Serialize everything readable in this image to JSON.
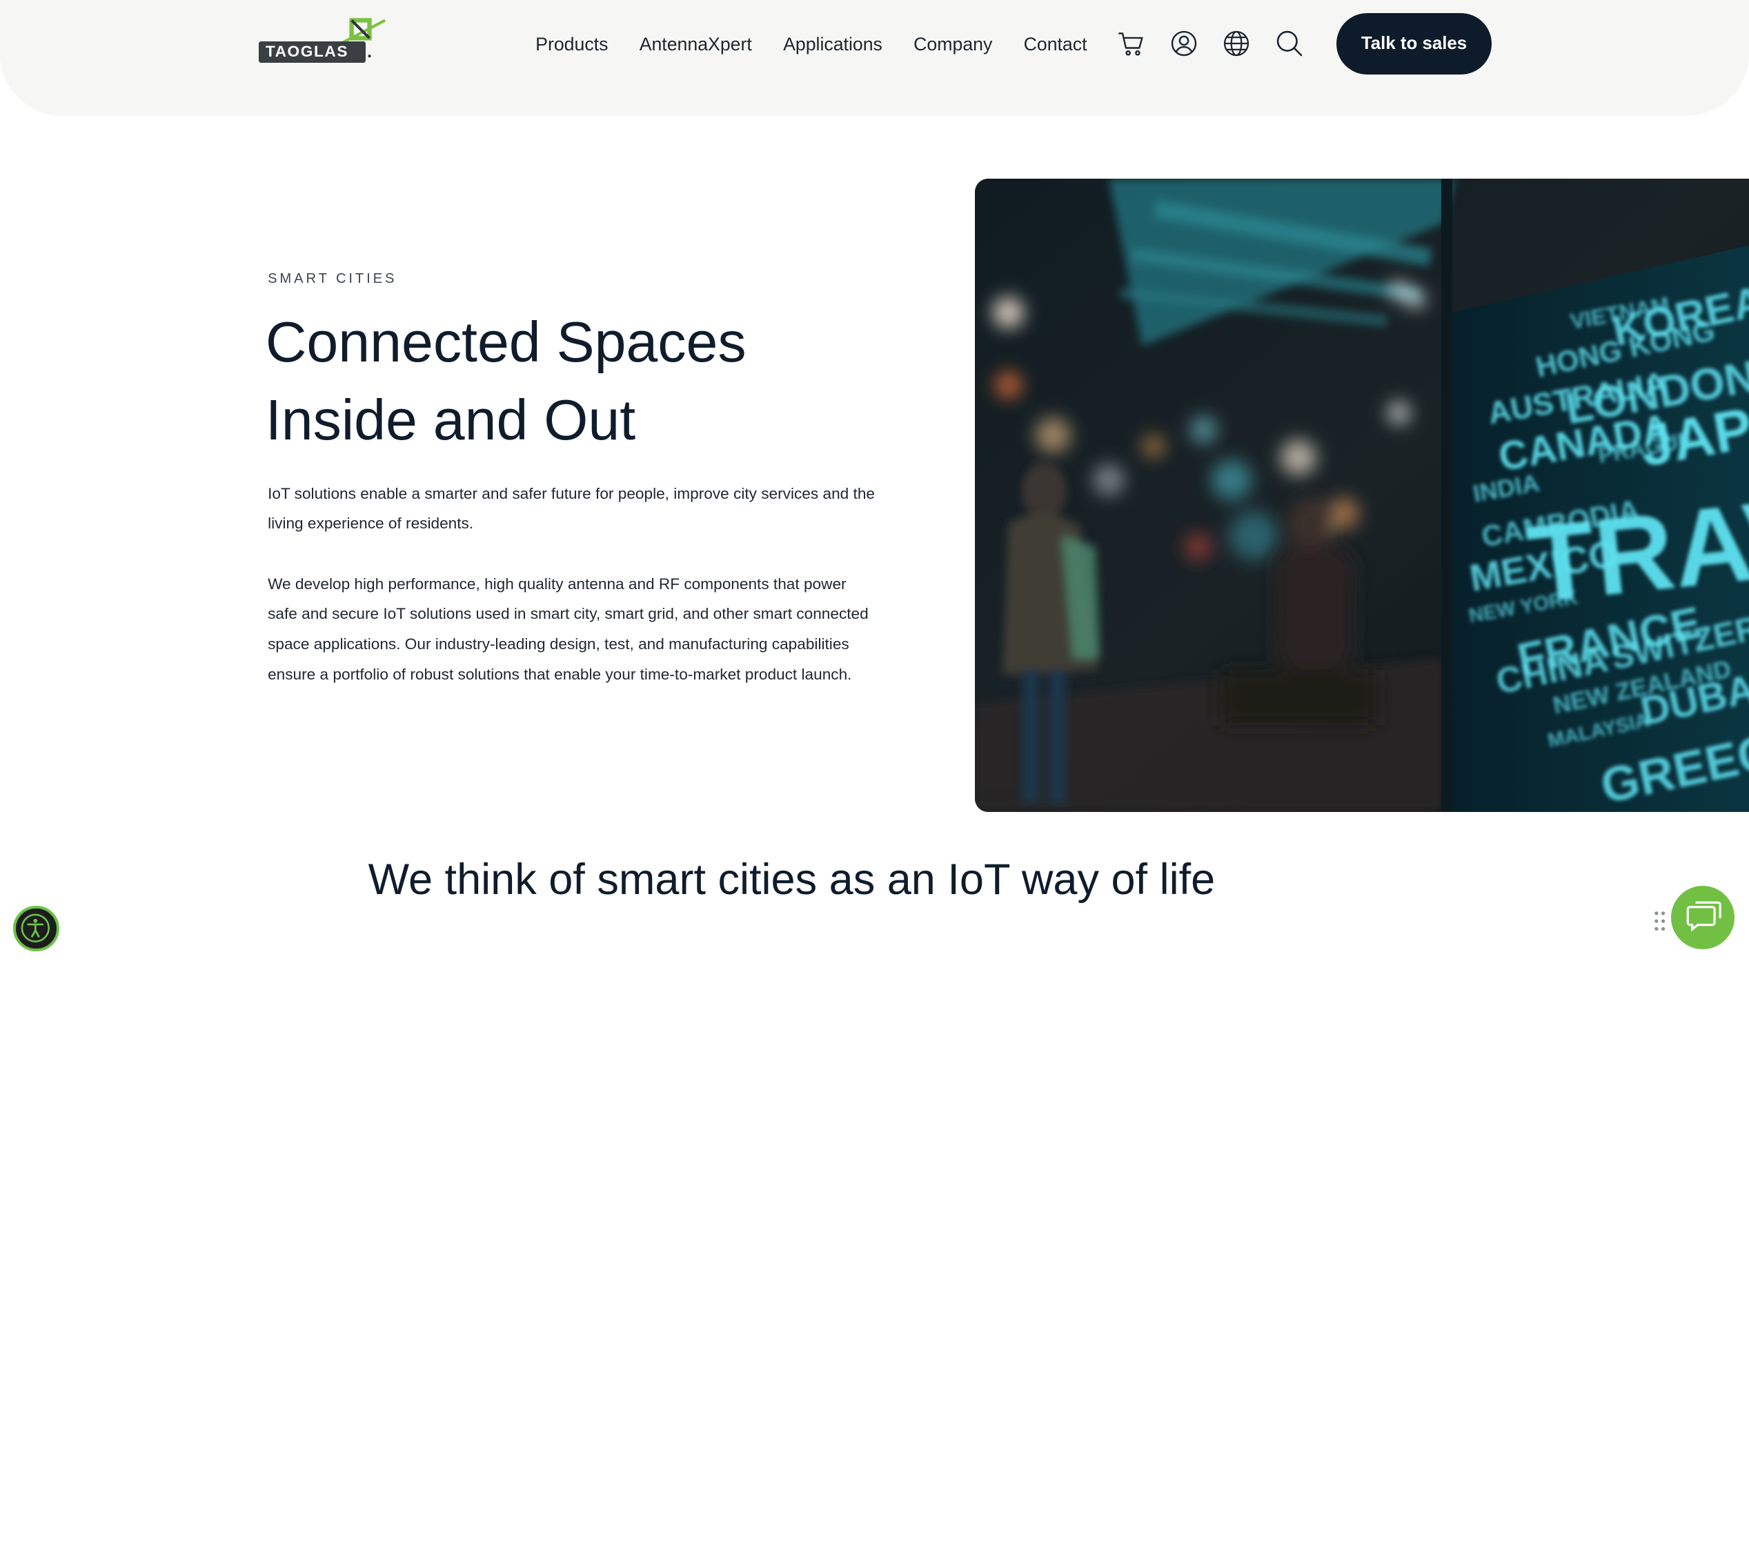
{
  "header": {
    "logo_text": "TAOGLAS",
    "nav": [
      "Products",
      "AntennaXpert",
      "Applications",
      "Company",
      "Contact"
    ],
    "icons": [
      "cart-icon",
      "user-icon",
      "globe-icon",
      "search-icon"
    ],
    "cta_label": "Talk to sales"
  },
  "hero": {
    "eyebrow": "SMART CITIES",
    "title_line1": "Connected Spaces",
    "title_line2": "Inside and Out",
    "paragraph1": "IoT solutions enable a smarter and safer future for people, improve city services and the living experience of residents.",
    "paragraph2": "We develop high performance, high quality antenna and RF components that power safe and secure IoT solutions used in smart city, smart grid, and other smart connected space applications. Our industry-leading design, test, and manufacturing capabilities ensure a portfolio of robust solutions that enable your time-to-market product launch.",
    "image_words": [
      "VIETNAM",
      "KOREA",
      "HONG KONG",
      "AUSTRALIA",
      "LONDON",
      "CANADA",
      "PRAGUE",
      "JAPAN",
      "INDIA",
      "CAMBODIA",
      "TRAVEL",
      "MEXICO",
      "NEW YORK",
      "FRANCE",
      "SWITZERLAND",
      "CHINA",
      "NEW ZEALAND",
      "DUBAI",
      "MALAYSIA",
      "GREECE"
    ]
  },
  "section": {
    "heading": "We think of smart cities as an IoT way of life"
  },
  "colors": {
    "accent_green": "#72c043",
    "dark_navy": "#0d1b2a",
    "header_bg": "#f6f6f4"
  }
}
